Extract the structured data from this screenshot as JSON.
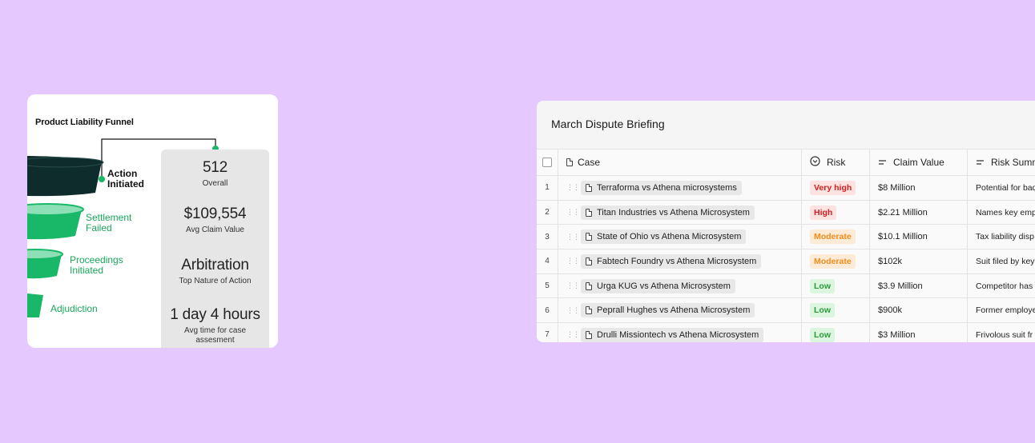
{
  "funnel": {
    "title": "Product Liability Funnel",
    "stages": [
      {
        "line1": "Action",
        "line2": "Initiated"
      },
      {
        "line1": "Settlement",
        "line2": "Failed"
      },
      {
        "line1": "Proceedings",
        "line2": "Initiated"
      },
      {
        "line1": "Adjudiction",
        "line2": ""
      }
    ],
    "colors": {
      "dark": "#0f2c2c",
      "green": "#18b868",
      "green_light": "#8de0b5"
    },
    "stats": [
      {
        "value": "512",
        "label": "Overall"
      },
      {
        "value": "$109,554",
        "label": "Avg Claim Value"
      },
      {
        "value": "Arbitration",
        "label": "Top Nature of Action"
      },
      {
        "value": "1 day 4 hours",
        "label": "Avg time for case assesment"
      }
    ]
  },
  "table": {
    "title": "March Dispute Briefing",
    "headers": {
      "case": "Case",
      "risk": "Risk",
      "claim_value": "Claim Value",
      "risk_summary": "Risk Summary"
    },
    "rows": [
      {
        "num": "1",
        "case": "Terraforma vs Athena microsystems",
        "risk": "Very high",
        "risk_level": "very-high",
        "claim": "$8 Million",
        "summary": "Potential for bad"
      },
      {
        "num": "2",
        "case": "Titan Industries vs Athena Microsystem",
        "risk": "High",
        "risk_level": "high",
        "claim": "$2.21 Million",
        "summary": "Names key emplo"
      },
      {
        "num": "3",
        "case": "State of Ohio vs Athena Microsystem",
        "risk": "Moderate",
        "risk_level": "moderate",
        "claim": "$10.1 Million",
        "summary": "Tax liability disp"
      },
      {
        "num": "4",
        "case": "Fabtech Foundry vs Athena Microsystem",
        "risk": "Moderate",
        "risk_level": "moderate",
        "claim": "$102k",
        "summary": "Suit filed by key"
      },
      {
        "num": "5",
        "case": "Urga KUG vs Athena Microsystem",
        "risk": "Low",
        "risk_level": "low",
        "claim": "$3.9 Million",
        "summary": "Competitor has"
      },
      {
        "num": "6",
        "case": "Peprall Hughes vs Athena Microsystem",
        "risk": "Low",
        "risk_level": "low",
        "claim": "$900k",
        "summary": "Former employe"
      },
      {
        "num": "7",
        "case": "Drulli Missiontech vs Athena Microsystem",
        "risk": "Low",
        "risk_level": "low",
        "claim": "$3 Million",
        "summary": "Frivolous suit fr"
      }
    ]
  }
}
